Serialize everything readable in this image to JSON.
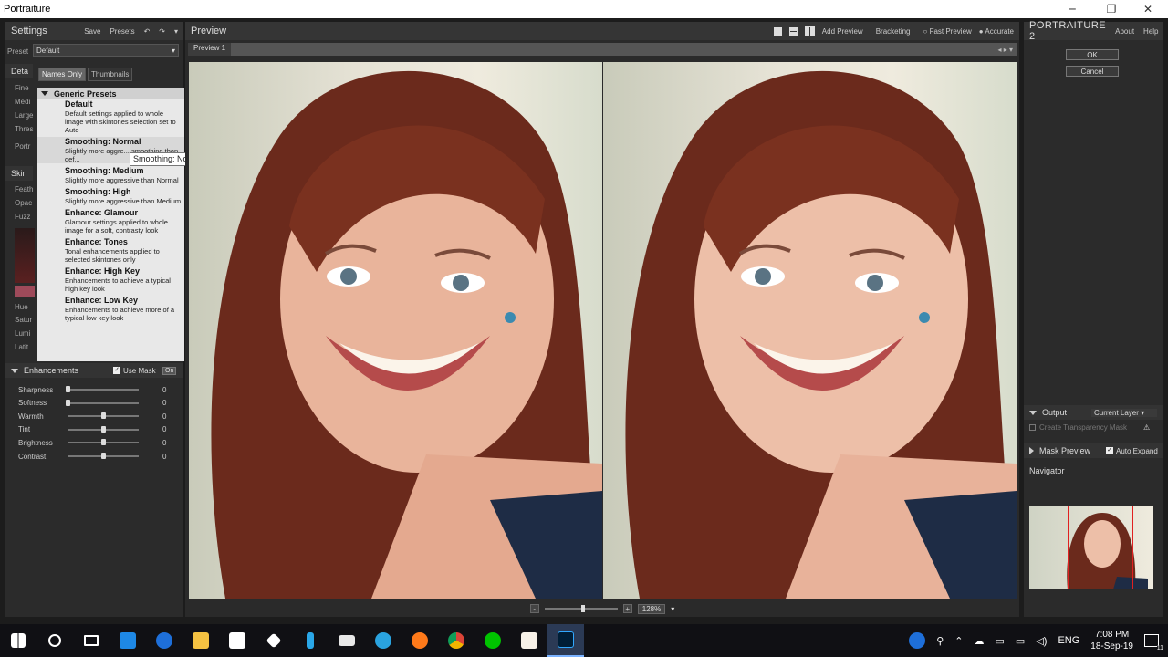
{
  "window": {
    "title": "Portraiture"
  },
  "left": {
    "settings_title": "Settings",
    "save": "Save",
    "presets": "Presets",
    "preset_label": "Preset",
    "preset_value": "Default",
    "detail_hdr": "Deta",
    "tabs": [
      "Names Only",
      "Thumbnails"
    ],
    "behind_labels": [
      "Fine",
      "Medi",
      "Large",
      "Thres",
      "Portr"
    ],
    "skin_hdr": "Skin",
    "skin_labels": [
      "Feath",
      "Opac",
      "Fuzz"
    ],
    "skin_labels2": [
      "Hue",
      "Satur",
      "Lumi",
      "Latit"
    ],
    "swatch_color": "#9e4a5a",
    "dropdown": {
      "group": "Generic Presets",
      "items": [
        {
          "name": "Default",
          "desc": "Default settings applied to whole image with skintones selection set to Auto"
        },
        {
          "name": "Smoothing: Normal",
          "desc": "Slightly more aggre... smoothing than def..."
        },
        {
          "name": "Smoothing: Medium",
          "desc": "Slightly more aggressive than Normal"
        },
        {
          "name": "Smoothing: High",
          "desc": "Slightly more aggressive than Medium"
        },
        {
          "name": "Enhance: Glamour",
          "desc": "Glamour settings applied to whole image for a soft, contrasty look"
        },
        {
          "name": "Enhance: Tones",
          "desc": "Tonal enhancements applied to selected skintones only"
        },
        {
          "name": "Enhance: High Key",
          "desc": "Enhancements to achieve a typical high key look"
        },
        {
          "name": "Enhance: Low Key",
          "desc": "Enhancements to achieve more of a typical low key look"
        }
      ]
    },
    "tooltip": "Smoothing: Normal",
    "enhancements": {
      "title": "Enhancements",
      "use_mask": "Use Mask",
      "on": "On",
      "sliders": [
        {
          "label": "Sharpness",
          "value": "0",
          "level": 0
        },
        {
          "label": "Softness",
          "value": "0",
          "level": 0
        },
        {
          "label": "Warmth",
          "value": "0",
          "level": 0.5
        },
        {
          "label": "Tint",
          "value": "0",
          "level": 0.5
        },
        {
          "label": "Brightness",
          "value": "0",
          "level": 0.5
        },
        {
          "label": "Contrast",
          "value": "0",
          "level": 0.5
        }
      ]
    }
  },
  "preview": {
    "title": "Preview",
    "add_preview": "Add Preview",
    "bracketing": "Bracketing",
    "fast_preview": "Fast Preview",
    "accurate": "Accurate",
    "tab": "Preview 1",
    "zoom": "128%"
  },
  "right": {
    "brand": "PORTRAITURE 2",
    "about": "About",
    "help": "Help",
    "ok": "OK",
    "cancel": "Cancel",
    "output": "Output",
    "current_layer": "Current Layer",
    "create_mask": "Create Transparency Mask",
    "mask_preview": "Mask Preview",
    "auto_expand": "Auto Expand",
    "navigator": "Navigator"
  },
  "taskbar": {
    "lang": "ENG",
    "time": "7:08 PM",
    "date": "18-Sep-19",
    "notif": "11",
    "icons": [
      "windows-icon",
      "search-icon",
      "task-view-icon",
      "vscode-icon",
      "edge-icon",
      "file-explorer-icon",
      "store-icon",
      "dropbox-icon",
      "bolt-icon",
      "mail-icon",
      "telegram-icon",
      "firefox-icon",
      "chrome-icon",
      "line-icon",
      "app-icon",
      "photoshop-icon"
    ]
  }
}
